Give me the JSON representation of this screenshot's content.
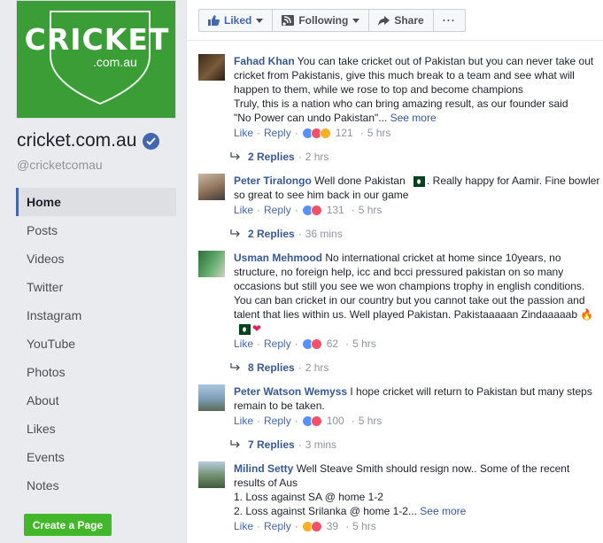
{
  "page": {
    "logo_line1": "CRICKET",
    "logo_line2": ".com.au",
    "name": "cricket.com.au",
    "handle": "@cricketcomau",
    "brand_color": "#3a9d35"
  },
  "sidebar": {
    "items": [
      {
        "label": "Home",
        "active": true
      },
      {
        "label": "Posts"
      },
      {
        "label": "Videos"
      },
      {
        "label": "Twitter"
      },
      {
        "label": "Instagram"
      },
      {
        "label": "YouTube"
      },
      {
        "label": "Photos"
      },
      {
        "label": "About"
      },
      {
        "label": "Likes"
      },
      {
        "label": "Events"
      },
      {
        "label": "Notes"
      }
    ],
    "create_label": "Create a Page"
  },
  "actions": {
    "liked": "Liked",
    "following": "Following",
    "share": "Share",
    "more": "···"
  },
  "labels": {
    "like": "Like",
    "reply": "Reply",
    "see_more": "See more"
  },
  "comments": [
    {
      "author": "Fahad Khan",
      "text": "You can take cricket out of Pakistan but you can never take out cricket from Pakistanis, give this much break to a team and see what will happen to them, while we rose to top and become champions",
      "text2": "Truly, this is a nation who can bring amazing result, as our founder said",
      "text3": "\"No Power can undo Pakistan\"...",
      "reactions": [
        "like",
        "love",
        "wow"
      ],
      "count": "121",
      "time": "5 hrs",
      "replies": "2 Replies",
      "replies_time": "2 hrs"
    },
    {
      "author": "Peter Tiralongo",
      "text": "Well done Pakistan",
      "text_after": ". Really happy for Aamir. Fine bowler so great to see him back in our game",
      "reactions": [
        "like",
        "love"
      ],
      "count": "131",
      "time": "5 hrs",
      "replies": "2 Replies",
      "replies_time": "36 mins"
    },
    {
      "author": "Usman Mehmood",
      "text": "No international cricket at home since 10years, no structure, no foreign help, icc and bcci pressured pakistan on so many occasions but still you see we won champions trophy in english conditions. You can ban cricket in our country but you cannot take out the passion and talent that lies within us. Well played Pakistan. Pakistaaaaan Zindaaaaab",
      "reactions": [
        "like",
        "love"
      ],
      "count": "62",
      "time": "5 hrs",
      "replies": "8 Replies",
      "replies_time": "2 hrs"
    },
    {
      "author": "Peter Watson Wemyss",
      "text": "I hope cricket will return to Pakistan but many steps remain to be taken.",
      "reactions": [
        "like",
        "love"
      ],
      "count": "100",
      "time": "5 hrs",
      "replies": "7 Replies",
      "replies_time": "3 mins"
    },
    {
      "author": "Milind Setty",
      "text": "Well Steave Smith should resign now.. Some of the recent results of Aus",
      "text2": "1. Loss against SA @ home 1-2",
      "text3": "2. Loss against Srilanka @ home 1-2...",
      "reactions": [
        "haha",
        "love"
      ],
      "count": "39",
      "time": "5 hrs"
    }
  ]
}
